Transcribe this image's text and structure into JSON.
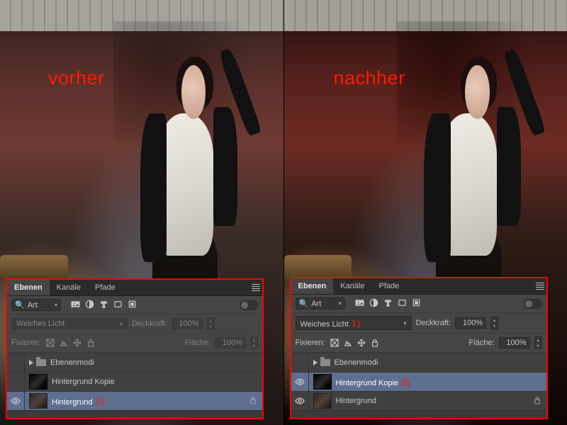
{
  "overlay": {
    "before": "vorher",
    "after": "nachher"
  },
  "annotations": {
    "blend": "1)",
    "bg_layer": "2)",
    "copy_layer": "3)"
  },
  "panel": {
    "tabs": {
      "layers": "Ebenen",
      "channels": "Kanäle",
      "paths": "Pfade"
    },
    "filter_kind": "Art",
    "blend_mode": "Weiches Licht",
    "opacity_label": "Deckkraft:",
    "fill_label": "Fläche:",
    "lock_label": "Fixieren:",
    "opacity_value_before": "100%",
    "fill_value_before": "100%",
    "opacity_value_after": "100%",
    "fill_value_after": "100%",
    "layers": {
      "group": "Ebenenmodi",
      "copy": "Hintergrund Kopie",
      "bg": "Hintergrund"
    }
  }
}
